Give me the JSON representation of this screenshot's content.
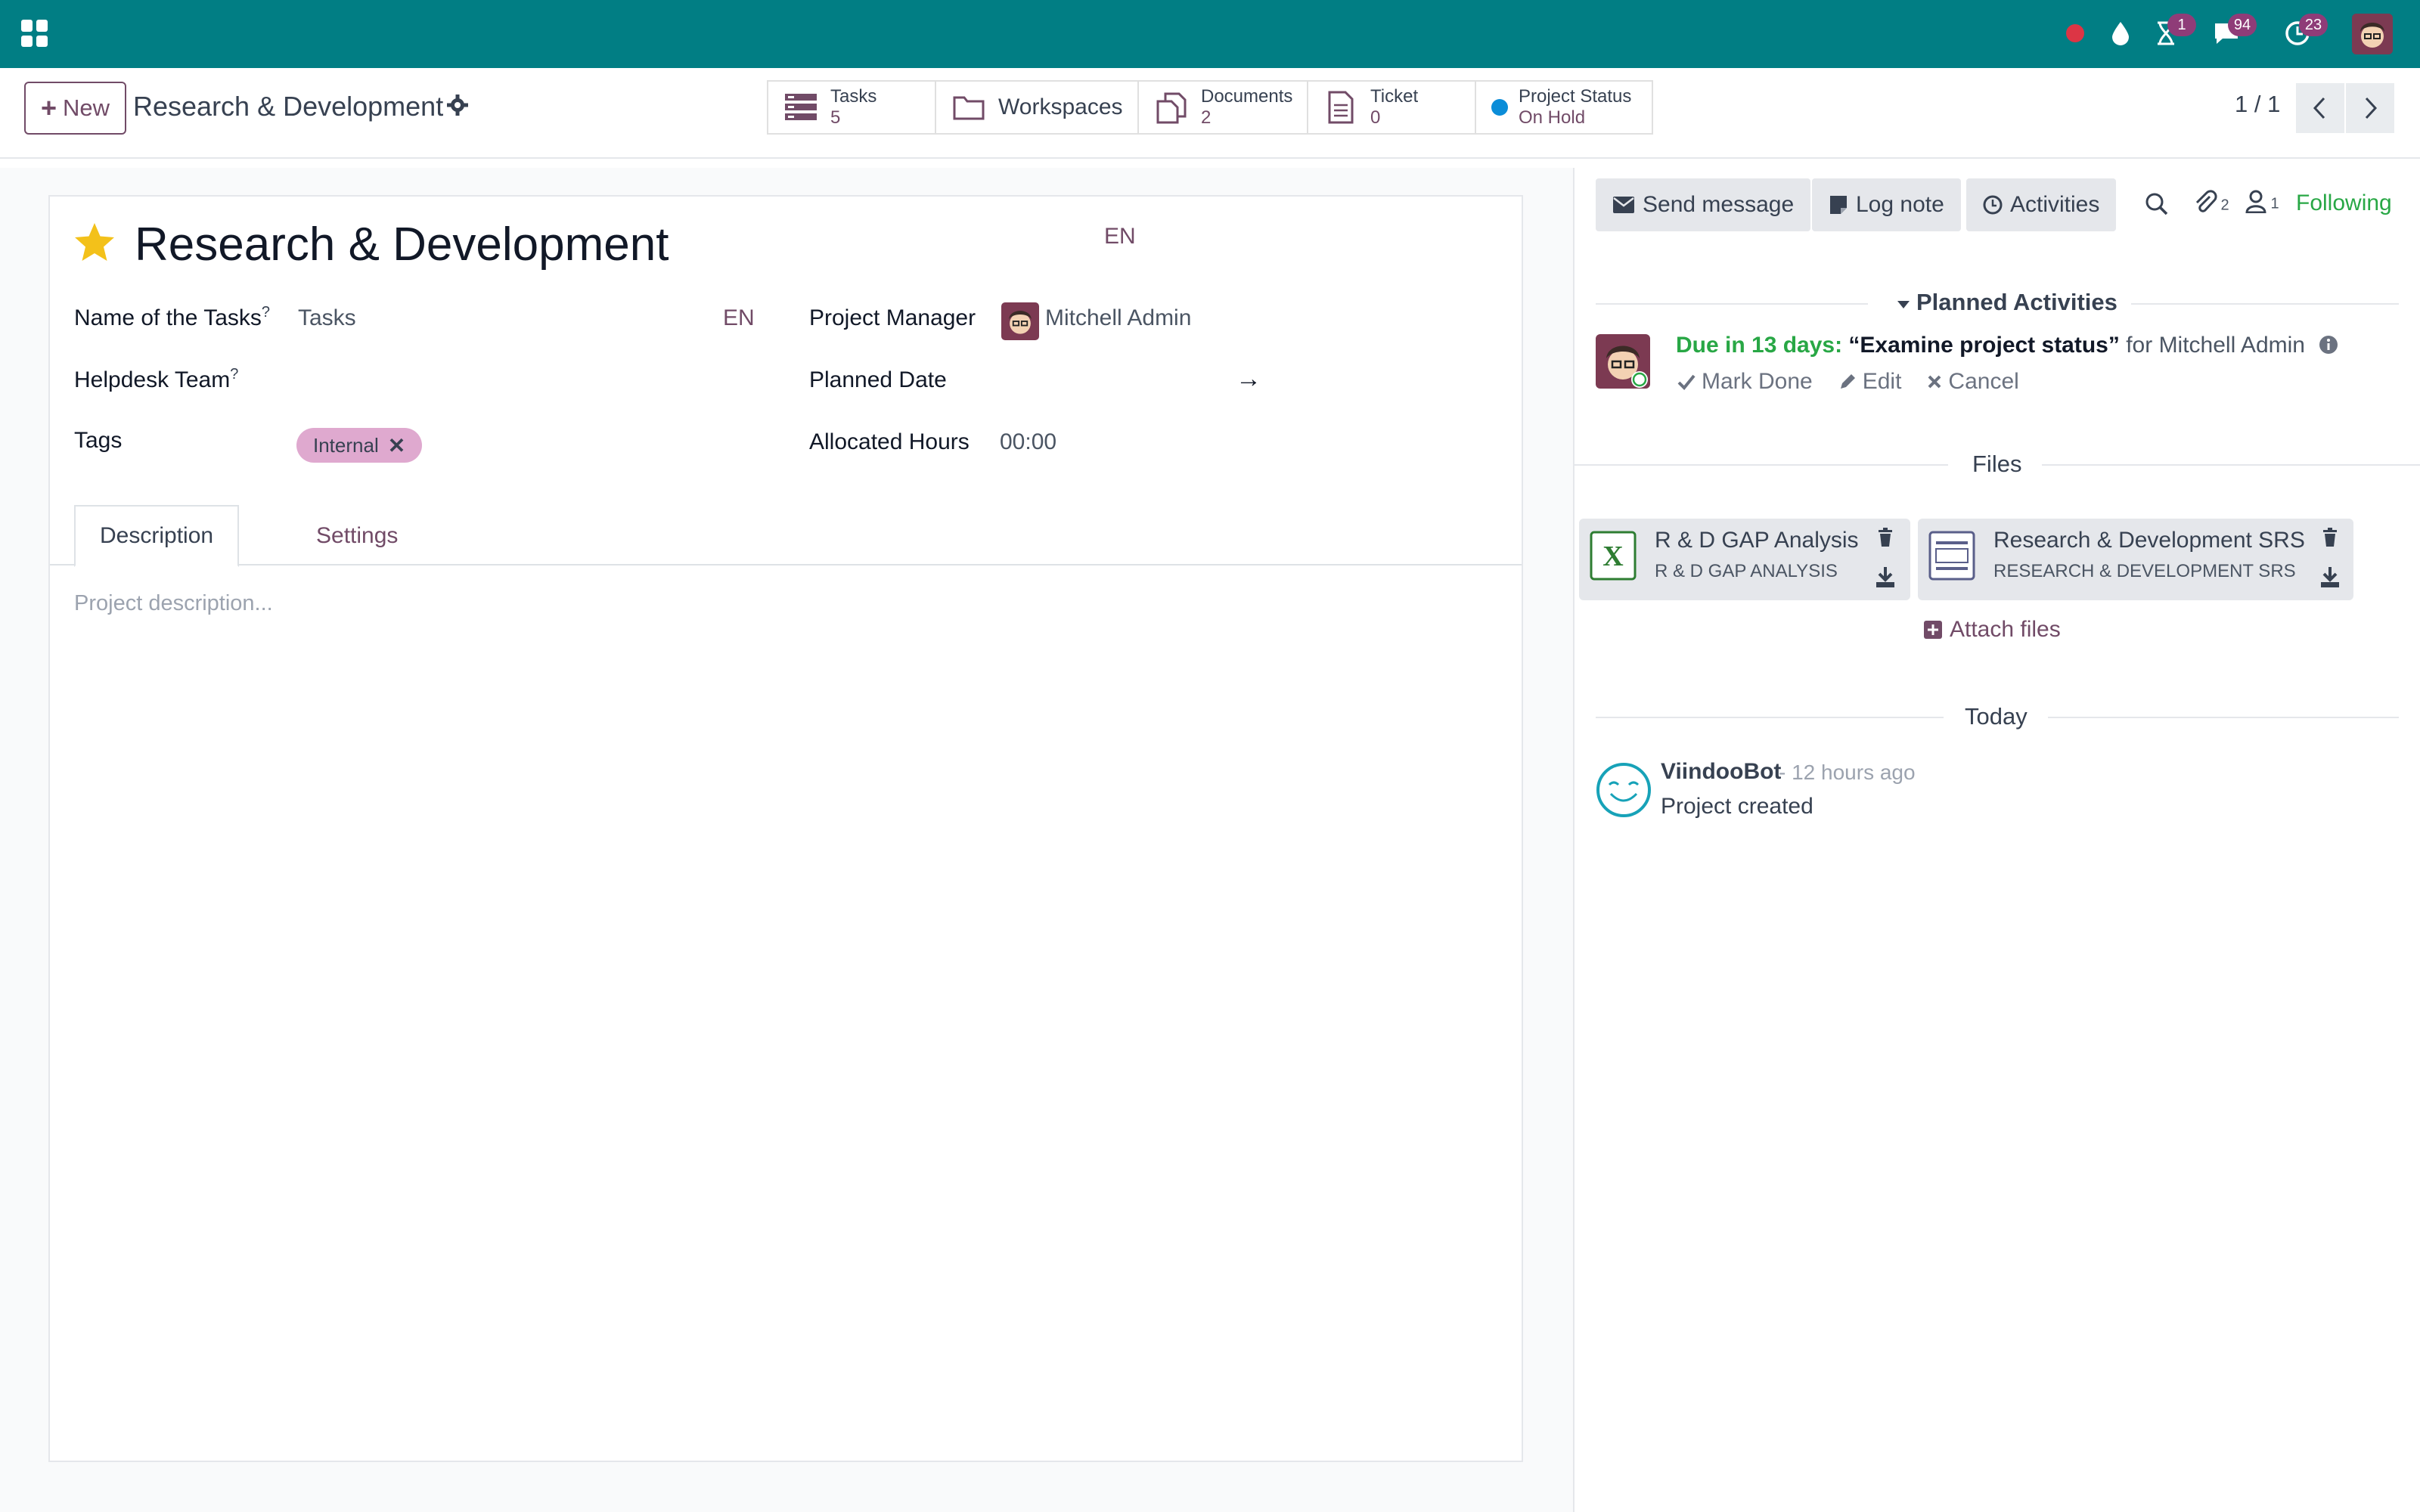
{
  "navbar": {
    "badges": {
      "activities": "1",
      "messages": "94",
      "updates": "23"
    }
  },
  "control_panel": {
    "new_label": "New",
    "breadcrumb_title": "Research & Development",
    "smart_buttons": {
      "tasks": {
        "label": "Tasks",
        "value": "5"
      },
      "workspaces": {
        "label": "Workspaces"
      },
      "documents": {
        "label": "Documents",
        "value": "2"
      },
      "ticket": {
        "label": "Ticket",
        "value": "0"
      },
      "project_status": {
        "label": "Project Status",
        "value": "On Hold"
      }
    },
    "pager": "1 / 1"
  },
  "form": {
    "record_name": "Research & Development",
    "lang": "EN",
    "fields": {
      "name_of_tasks": {
        "label": "Name of the Tasks",
        "help": "?",
        "value": "Tasks",
        "lang": "EN"
      },
      "helpdesk_team": {
        "label": "Helpdesk Team",
        "help": "?"
      },
      "tags": {
        "label": "Tags",
        "tag": "Internal"
      },
      "project_manager": {
        "label": "Project Manager",
        "value": "Mitchell Admin"
      },
      "planned_date": {
        "label": "Planned Date",
        "arrow": "→"
      },
      "allocated_hours": {
        "label": "Allocated Hours",
        "value": "00:00"
      }
    },
    "tabs": [
      "Description",
      "Settings"
    ],
    "description_placeholder": "Project description..."
  },
  "chatter": {
    "buttons": {
      "send_message": "Send message",
      "log_note": "Log note",
      "activities": "Activities"
    },
    "attachment_count": "2",
    "follower_count": "1",
    "following": "Following",
    "planned_activities_label": "Planned Activities",
    "activity": {
      "due": "Due in 13 days:",
      "summary": "“Examine project status”",
      "assignee": "for Mitchell Admin",
      "mark_done": "Mark Done",
      "edit": "Edit",
      "cancel": "Cancel"
    },
    "files_label": "Files",
    "files": [
      {
        "name": "R & D GAP Analysis",
        "ext": "R & D GAP ANALYSIS"
      },
      {
        "name": "Research & Development SRS",
        "ext": "RESEARCH & DEVELOPMENT SRS"
      }
    ],
    "attach_files": "Attach files",
    "today_label": "Today",
    "message": {
      "author": "ViindooBot",
      "date": "- 12 hours ago",
      "body": "Project created"
    }
  },
  "colors": {
    "navbar": "#017e84",
    "primary": "#714b67",
    "success": "#28a745",
    "tag": "#dfa9cf"
  }
}
